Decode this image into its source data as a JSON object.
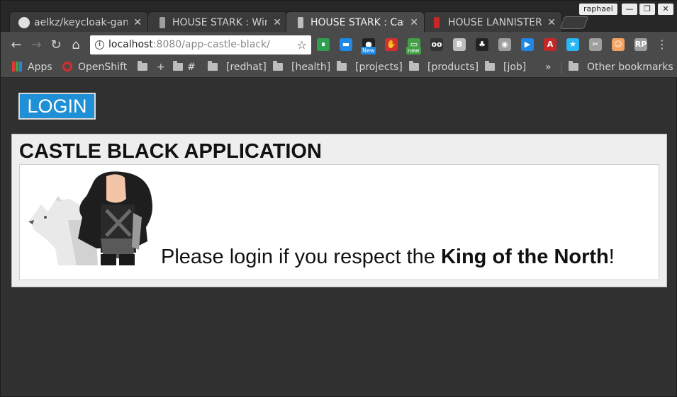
{
  "browser": {
    "profile_name": "raphael",
    "window_controls": {
      "minimize": "—",
      "maximize": "❐",
      "close": "✕"
    },
    "tabs": [
      {
        "title": "aelkz/keycloak-game",
        "icon": "github-icon",
        "active": false
      },
      {
        "title": "HOUSE STARK : Win",
        "icon": "stark-sigil-icon",
        "active": false
      },
      {
        "title": "HOUSE STARK : Cas",
        "icon": "stark-sigil-icon",
        "active": true
      },
      {
        "title": "HOUSE LANNISTER",
        "icon": "lannister-sigil-icon",
        "active": false
      }
    ],
    "tab_close": "✕",
    "toolbar": {
      "back": "←",
      "forward": "→",
      "reload": "↻",
      "home": "⌂",
      "url_host": "localhost",
      "url_path": ":8080/app-castle-black/",
      "bookmark_star": "☆",
      "menu": "⋮"
    },
    "extensions": [
      {
        "name": "pushbullet-icon",
        "color": "#2e9e4f",
        "glyph": "⏸"
      },
      {
        "name": "screen-icon",
        "color": "#1e88e5",
        "glyph": "▬"
      },
      {
        "name": "new-extension-icon",
        "color": "#222222",
        "glyph": "●",
        "badge": "New"
      },
      {
        "name": "adblock-icon",
        "color": "#d32f2f",
        "glyph": "✋"
      },
      {
        "name": "new-download-icon",
        "color": "#43a047",
        "glyph": "▭",
        "badge": "new"
      },
      {
        "name": "goggles-icon",
        "color": "#333333",
        "glyph": "oo"
      },
      {
        "name": "b-icon",
        "color": "#bdbdbd",
        "glyph": "B"
      },
      {
        "name": "gnome-icon",
        "color": "#222222",
        "glyph": "♣"
      },
      {
        "name": "camera-icon",
        "color": "#9e9e9e",
        "glyph": "◉"
      },
      {
        "name": "video-call-icon",
        "color": "#1e88e5",
        "glyph": "▶"
      },
      {
        "name": "font-a-icon",
        "color": "#c62828",
        "glyph": "A"
      },
      {
        "name": "star-extension-icon",
        "color": "#29b6f6",
        "glyph": "★"
      },
      {
        "name": "tools-icon",
        "color": "#9e9e9e",
        "glyph": "✂"
      },
      {
        "name": "face-icon",
        "color": "#f4a261",
        "glyph": "☺"
      },
      {
        "name": "rp-icon",
        "color": "#9e9e9e",
        "glyph": "RP"
      }
    ],
    "bookmarks": [
      {
        "label": "Apps",
        "icon": "apps-icon"
      },
      {
        "label": "OpenShift",
        "icon": "openshift-icon"
      },
      {
        "label": "",
        "icon": "folder-icon"
      },
      {
        "label": "+",
        "icon": "folder-icon"
      },
      {
        "label": "#",
        "icon": "folder-icon"
      },
      {
        "label": "[redhat]",
        "icon": "folder-icon"
      },
      {
        "label": "[health]",
        "icon": "folder-icon"
      },
      {
        "label": "[projects]",
        "icon": "folder-icon"
      },
      {
        "label": "[products]",
        "icon": "folder-icon"
      },
      {
        "label": "[job]",
        "icon": "folder-icon"
      }
    ],
    "bookmarks_overflow": "»",
    "other_bookmarks": "Other bookmarks"
  },
  "page": {
    "login_label": "LOGIN",
    "title": "CASTLE BLACK APPLICATION",
    "message_prefix": "Please login if you respect the ",
    "message_bold": "King of the North",
    "message_suffix": "!"
  }
}
